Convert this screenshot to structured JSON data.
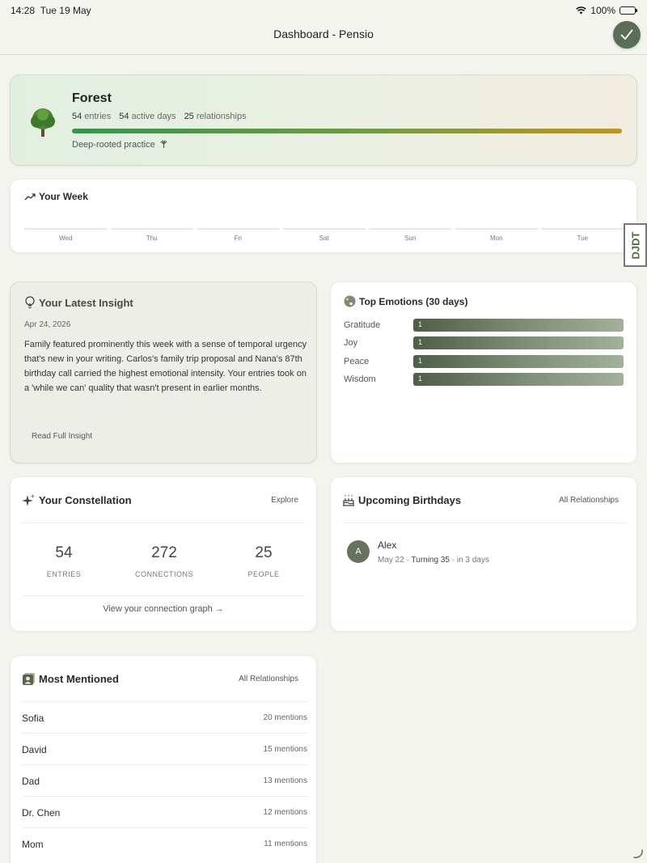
{
  "status": {
    "time": "14:28",
    "date": "Tue 19 May",
    "battery": "100%"
  },
  "nav": {
    "title": "Dashboard - Pensio"
  },
  "forest": {
    "name": "Forest",
    "entries_num": "54",
    "entries_lbl": "entries",
    "days_num": "54",
    "days_lbl": "active days",
    "rel_num": "25",
    "rel_lbl": "relationships",
    "practice": "Deep-rooted practice",
    "progress": 1.0
  },
  "week": {
    "title": "Your Week",
    "days": [
      "Wed",
      "Thu",
      "Fri",
      "Sat",
      "Sun",
      "Mon",
      "Tue"
    ]
  },
  "side_tab": "DJDT",
  "insight": {
    "title": "Your Latest Insight",
    "date": "Apr 24, 2026",
    "body": "Family featured prominently this week with a sense of temporal urgency that's new in your writing. Carlos's family trip proposal and Nana's 87th birthday call carried the highest emotional intensity. Your entries took on a 'while we can' quality that wasn't present in earlier months.",
    "link": "Read Full Insight"
  },
  "emotions": {
    "title": "Top Emotions (30 days)",
    "items": [
      {
        "label": "Gratitude",
        "value": "1"
      },
      {
        "label": "Joy",
        "value": "1"
      },
      {
        "label": "Peace",
        "value": "1"
      },
      {
        "label": "Wisdom",
        "value": "1"
      }
    ]
  },
  "constellation": {
    "title": "Your Constellation",
    "action": "Explore",
    "stats": [
      {
        "num": "54",
        "label": "ENTRIES"
      },
      {
        "num": "272",
        "label": "CONNECTIONS"
      },
      {
        "num": "25",
        "label": "PEOPLE"
      }
    ],
    "view_link": "View your connection graph →"
  },
  "birthdays": {
    "title": "Upcoming Birthdays",
    "action": "All Relationships",
    "person": {
      "initial": "A",
      "name": "Alex",
      "date": "May 22",
      "turning": "Turning 35",
      "when": "in 3 days"
    }
  },
  "mentioned": {
    "title": "Most Mentioned",
    "action": "All Relationships",
    "rows": [
      {
        "name": "Sofia",
        "count": "20 mentions"
      },
      {
        "name": "David",
        "count": "15 mentions"
      },
      {
        "name": "Dad",
        "count": "13 mentions"
      },
      {
        "name": "Dr. Chen",
        "count": "12 mentions"
      },
      {
        "name": "Mom",
        "count": "11 mentions"
      }
    ]
  },
  "colors": {
    "accent": "#5b6d55",
    "bar_start": "#2e9a47",
    "bar_end": "#c7921a"
  }
}
